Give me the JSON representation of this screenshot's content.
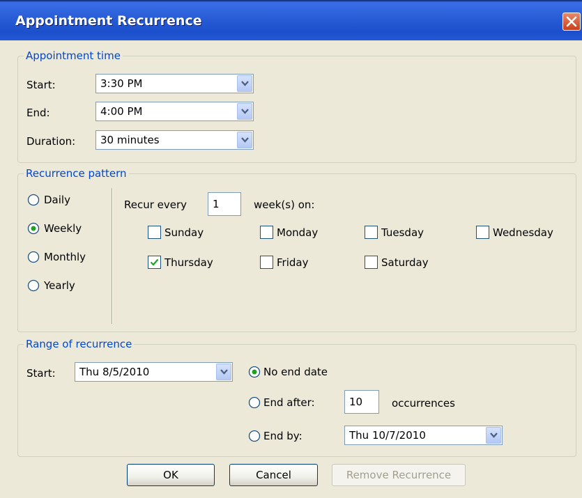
{
  "window": {
    "title": "Appointment Recurrence"
  },
  "appointment_time": {
    "legend": "Appointment time",
    "start_label": "Start:",
    "start_value": "3:30 PM",
    "end_label": "End:",
    "end_value": "4:00 PM",
    "duration_label": "Duration:",
    "duration_value": "30 minutes"
  },
  "recurrence_pattern": {
    "legend": "Recurrence pattern",
    "options": [
      {
        "label": "Daily",
        "checked": false
      },
      {
        "label": "Weekly",
        "checked": true
      },
      {
        "label": "Monthly",
        "checked": false
      },
      {
        "label": "Yearly",
        "checked": false
      }
    ],
    "recur_every_label": "Recur every",
    "recur_every_value": "1",
    "weeks_on_label": "week(s) on:",
    "days": [
      {
        "label": "Sunday",
        "checked": false
      },
      {
        "label": "Monday",
        "checked": false
      },
      {
        "label": "Tuesday",
        "checked": false
      },
      {
        "label": "Wednesday",
        "checked": false
      },
      {
        "label": "Thursday",
        "checked": true
      },
      {
        "label": "Friday",
        "checked": false
      },
      {
        "label": "Saturday",
        "checked": false
      }
    ]
  },
  "range": {
    "legend": "Range of recurrence",
    "start_label": "Start:",
    "start_value": "Thu 8/5/2010",
    "no_end_label": "No end date",
    "end_after_label": "End after:",
    "end_after_value": "10",
    "occurrences_label": "occurrences",
    "end_by_label": "End by:",
    "end_by_value": "Thu 10/7/2010",
    "selected": "no_end"
  },
  "buttons": {
    "ok": "OK",
    "cancel": "Cancel",
    "remove": "Remove Recurrence"
  },
  "colors": {
    "legend": "#0046d5",
    "title_bar": "#2a5fd8",
    "dialog_bg": "#ece9d8"
  }
}
